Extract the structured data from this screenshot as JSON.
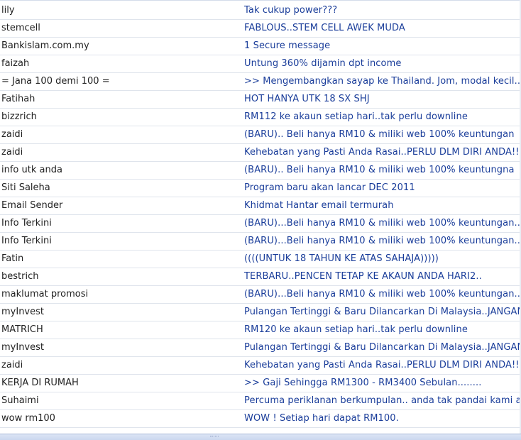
{
  "messages": [
    {
      "sender": "lily",
      "subject": "Tak cukup power???"
    },
    {
      "sender": "stemcell",
      "subject": "FABLOUS..STEM CELL AWEK MUDA"
    },
    {
      "sender": "Bankislam.com.my",
      "subject": "1 Secure message"
    },
    {
      "sender": "faizah",
      "subject": "Untung 360% dijamin dpt income"
    },
    {
      "sender": "= Jana 100 demi 100 =",
      "subject": ">> Mengembangkan sayap ke Thailand. Jom, modal kecil......"
    },
    {
      "sender": "Fatihah",
      "subject": "HOT HANYA UTK 18 SX SHJ"
    },
    {
      "sender": "bizzrich",
      "subject": "RM112 ke akaun setiap hari..tak perlu downline"
    },
    {
      "sender": "zaidi",
      "subject": "(BARU).. Beli hanya RM10 & miliki web 100% keuntungan"
    },
    {
      "sender": "zaidi",
      "subject": "Kehebatan yang Pasti Anda Rasai..PERLU DLM DIRI ANDA!!!"
    },
    {
      "sender": "info utk anda",
      "subject": "(BARU).. Beli hanya RM10 & miliki web 100% keuntungna"
    },
    {
      "sender": "Siti Saleha",
      "subject": "Program baru akan lancar DEC 2011"
    },
    {
      "sender": "Email Sender",
      "subject": "Khidmat Hantar email termurah"
    },
    {
      "sender": "Info Terkini",
      "subject": "(BARU)...Beli hanya RM10 & miliki web 100% keuntungan.."
    },
    {
      "sender": "Info Terkini",
      "subject": "(BARU)...Beli hanya RM10 & miliki web 100% keuntungan.."
    },
    {
      "sender": "Fatin",
      "subject": "((((UNTUK 18 TAHUN KE ATAS SAHAJA)))))"
    },
    {
      "sender": "bestrich",
      "subject": "TERBARU..PENCEN TETAP KE AKAUN ANDA HARI2.."
    },
    {
      "sender": "maklumat promosi",
      "subject": "(BARU)...Beli hanya RM10 & miliki web 100% keuntungan.."
    },
    {
      "sender": "myInvest",
      "subject": "Pulangan Tertinggi & Baru Dilancarkan Di Malaysia..JANGAN"
    },
    {
      "sender": "MATRICH",
      "subject": "RM120 ke akaun setiap hari..tak perlu downline"
    },
    {
      "sender": "myInvest",
      "subject": "Pulangan Tertinggi & Baru Dilancarkan Di Malaysia..JANGAN"
    },
    {
      "sender": "zaidi",
      "subject": "Kehebatan yang Pasti Anda Rasai..PERLU DLM DIRI ANDA!!!"
    },
    {
      "sender": "KERJA DI RUMAH",
      "subject": ">> Gaji Sehingga RM1300 - RM3400 Sebulan........"
    },
    {
      "sender": "Suhaimi",
      "subject": "Percuma periklanan berkumpulan.. anda tak pandai kami aka"
    },
    {
      "sender": "wow rm100",
      "subject": "WOW ! Setiap hari dapat RM100."
    }
  ],
  "colors": {
    "sender_text": "#222222",
    "subject_text": "#1a3d9a",
    "row_divider": "#dfe4ec"
  }
}
